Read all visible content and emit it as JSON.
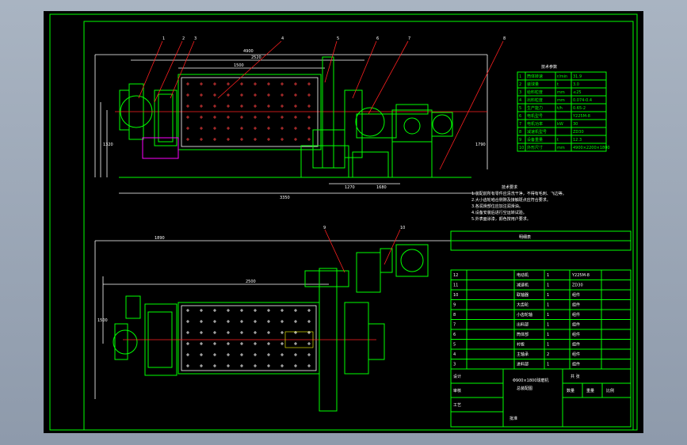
{
  "drawing": {
    "type": "cad-assembly-drawing",
    "background": "#000000",
    "frame_color": "#00ff00",
    "dimension_color": "#ffffff",
    "leader_color": "#ff2020"
  },
  "front_view": {
    "dim_labels": [
      "2520",
      "1500",
      "3350",
      "1270",
      "1680",
      "1320",
      "4900",
      "1790"
    ],
    "leader_tags": [
      "1",
      "2",
      "3",
      "4",
      "5",
      "6",
      "7",
      "8"
    ]
  },
  "top_view": {
    "dim_labels": [
      "2500",
      "1500",
      "1890"
    ],
    "leader_tags": [
      "9",
      "10"
    ]
  },
  "spec_table": {
    "title": "技术参数",
    "rows": [
      [
        "1",
        "筒体转速",
        "r/min",
        "31.9"
      ],
      [
        "2",
        "装球量",
        "t",
        "3.0"
      ],
      [
        "3",
        "给料粒度",
        "mm",
        "≤25"
      ],
      [
        "4",
        "出料粒度",
        "mm",
        "0.074-0.4"
      ],
      [
        "5",
        "生产能力",
        "t/h",
        "0.65-2"
      ],
      [
        "6",
        "电机型号",
        "",
        "Y225M-8"
      ],
      [
        "7",
        "电机功率",
        "kW",
        "30"
      ],
      [
        "8",
        "减速机型号",
        "",
        "ZD30"
      ],
      [
        "9",
        "设备重量",
        "t",
        "12.3"
      ],
      [
        "10",
        "外形尺寸",
        "mm",
        "4900×2200×1800"
      ]
    ]
  },
  "notes": {
    "title": "技术要求",
    "lines": [
      "1.装配前所有零件应清洗干净，不得有毛刺、飞边等。",
      "2.大小齿轮啮合侧隙及接触斑点应符合要求。",
      "3.各润滑部位应加注润滑油。",
      "4.设备安装后进行空运转试验。",
      "5.外表面涂漆，颜色按用户要求。"
    ]
  },
  "title_block": {
    "header": "明细表",
    "part_rows": [
      [
        "12",
        "",
        "电动机",
        "1",
        "Y225M-8"
      ],
      [
        "11",
        "",
        "减速机",
        "1",
        "ZD30"
      ],
      [
        "10",
        "",
        "联轴器",
        "1",
        "组件"
      ],
      [
        "9",
        "",
        "大齿轮",
        "1",
        "组件"
      ],
      [
        "8",
        "",
        "小齿轮轴",
        "1",
        "组件"
      ],
      [
        "7",
        "",
        "出料部",
        "1",
        "组件"
      ],
      [
        "6",
        "",
        "筒体部",
        "1",
        "组件"
      ],
      [
        "5",
        "",
        "衬板",
        "1",
        "组件"
      ],
      [
        "4",
        "",
        "主轴承",
        "2",
        "组件"
      ],
      [
        "3",
        "",
        "进料部",
        "1",
        "组件"
      ]
    ],
    "drawing_title": "Φ900×1800球磨机",
    "drawing_subtitle": "总装配图",
    "labels": {
      "design": "设计",
      "check": "审核",
      "process": "工艺",
      "approve": "批准",
      "scale": "比例",
      "sheet": "共 张",
      "quantity": "数量",
      "material": "重量"
    }
  }
}
